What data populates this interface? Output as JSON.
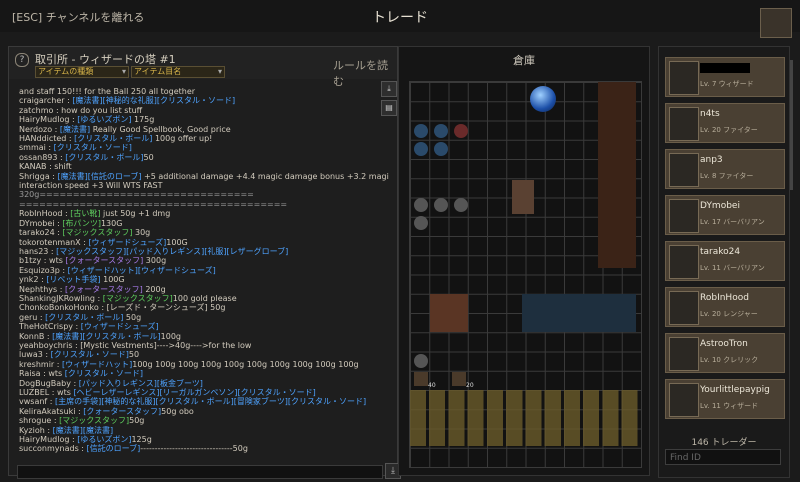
{
  "topbar": {
    "esc_label": "[ESC] チャンネルを離れる",
    "title": "トレード"
  },
  "chat": {
    "header_title": "取引所 - ウィザードの塔 #1",
    "filter_type": "アイテムの種類",
    "filter_name": "アイテム目名",
    "rules_label": "ルールを読む"
  },
  "chat_lines": [
    [
      {
        "t": "and staff 150!!! for the Ball 250 all together",
        "c": ""
      }
    ],
    [
      {
        "t": "craigarcher : ",
        "c": ""
      },
      {
        "t": "[魔法書][神秘的な礼服][クリスタル・ソード]",
        "c": "b"
      }
    ],
    [
      {
        "t": "zatchmo : how do you list stuff",
        "c": ""
      }
    ],
    [
      {
        "t": "HairyMudlog : ",
        "c": ""
      },
      {
        "t": "[ゆるいズボン]",
        "c": "b"
      },
      {
        "t": " 175g",
        "c": ""
      }
    ],
    [
      {
        "t": "Nerdozo : ",
        "c": ""
      },
      {
        "t": "[魔法書]",
        "c": "b"
      },
      {
        "t": " Really Good Spellbook, Good price",
        "c": ""
      }
    ],
    [
      {
        "t": "HANddicted : ",
        "c": ""
      },
      {
        "t": "[クリスタル・ボール]",
        "c": "b"
      },
      {
        "t": " 100g offer up!",
        "c": ""
      }
    ],
    [
      {
        "t": "smmai : ",
        "c": ""
      },
      {
        "t": "[クリスタル・ソード]",
        "c": "b"
      }
    ],
    [
      {
        "t": "ossan893 : ",
        "c": ""
      },
      {
        "t": "[クリスタル・ボール]",
        "c": "b"
      },
      {
        "t": "50",
        "c": ""
      }
    ],
    [
      {
        "t": "KANAB : shift",
        "c": ""
      }
    ],
    [
      {
        "t": "Shrigga : ",
        "c": ""
      },
      {
        "t": "[魔法書][信託のローブ]",
        "c": "b"
      },
      {
        "t": " +5 additional damage +4.4 magic damage bonus +3.2 magic",
        "c": ""
      }
    ],
    [
      {
        "t": "interaction speed +3 Will WTS FAST",
        "c": ""
      }
    ],
    [
      {
        "t": "320g================================",
        "c": "sep"
      }
    ],
    [
      {
        "t": "========================================",
        "c": "sep"
      }
    ],
    [
      {
        "t": "RobInHood : ",
        "c": ""
      },
      {
        "t": "                        [古い靴]",
        "c": "g"
      },
      {
        "t": "  just 50g   +1 dmg",
        "c": ""
      }
    ],
    [
      {
        "t": "DYmobei : ",
        "c": ""
      },
      {
        "t": "[布パンツ]",
        "c": "g"
      },
      {
        "t": "130G",
        "c": ""
      }
    ],
    [
      {
        "t": "tarako24 : ",
        "c": ""
      },
      {
        "t": "[マジックスタッフ]",
        "c": "g"
      },
      {
        "t": " 30g",
        "c": ""
      }
    ],
    [
      {
        "t": "tokorotenmanX : ",
        "c": ""
      },
      {
        "t": "[ウィザードシューズ]",
        "c": "b"
      },
      {
        "t": "100G",
        "c": ""
      }
    ],
    [
      {
        "t": "hans23 : ",
        "c": ""
      },
      {
        "t": "[マジックスタッフ][パッド入りレギンス][礼服][レザーグローブ]",
        "c": "b"
      }
    ],
    [
      {
        "t": "b1tzy : wts ",
        "c": ""
      },
      {
        "t": "[クォータースタッフ]",
        "c": "p"
      },
      {
        "t": " 300g",
        "c": ""
      }
    ],
    [
      {
        "t": "Esquizo3p : ",
        "c": ""
      },
      {
        "t": "[ウィザードハット][ウィザードシューズ]",
        "c": "b"
      }
    ],
    [
      {
        "t": "ynk2 : ",
        "c": ""
      },
      {
        "t": "[リベット手袋]",
        "c": "b"
      },
      {
        "t": " 100G",
        "c": ""
      }
    ],
    [
      {
        "t": "Nephthys : ",
        "c": ""
      },
      {
        "t": "[クォータースタッフ]",
        "c": "p"
      },
      {
        "t": " 200g",
        "c": ""
      }
    ],
    [
      {
        "t": "ShankingJKRowling : ",
        "c": ""
      },
      {
        "t": "[マジックスタッフ]",
        "c": "g"
      },
      {
        "t": "100 gold please",
        "c": ""
      }
    ],
    [
      {
        "t": "ChonkoBonkoHonko : ",
        "c": ""
      },
      {
        "t": "[レーズド・ターンシューズ]",
        "c": ""
      },
      {
        "t": " 50g",
        "c": ""
      }
    ],
    [
      {
        "t": "geru : ",
        "c": ""
      },
      {
        "t": "[クリスタル・ボール]",
        "c": "b"
      },
      {
        "t": " 50g",
        "c": ""
      }
    ],
    [
      {
        "t": "TheHotCrispy : ",
        "c": ""
      },
      {
        "t": "[ウィザードシューズ]",
        "c": "b"
      }
    ],
    [
      {
        "t": "KonnB : ",
        "c": ""
      },
      {
        "t": "[魔法書][クリスタル・ボール]",
        "c": "b"
      },
      {
        "t": "100g",
        "c": ""
      }
    ],
    [
      {
        "t": "yeahboychris : [Mystic Vestments]---->40g---->for the low",
        "c": ""
      }
    ],
    [
      {
        "t": "luwa3 : ",
        "c": ""
      },
      {
        "t": "[クリスタル・ソード]",
        "c": "b"
      },
      {
        "t": "50",
        "c": ""
      }
    ],
    [
      {
        "t": "kreshmir : ",
        "c": ""
      },
      {
        "t": "[ウィザードハット]",
        "c": "b"
      },
      {
        "t": "100g 100g 100g 100g 100g 100g 100g 100g 100g 100g",
        "c": ""
      }
    ],
    [
      {
        "t": "Raisa : wts ",
        "c": ""
      },
      {
        "t": "[クリスタル・ソード]",
        "c": "b"
      }
    ],
    [
      {
        "t": "DogBugBaby : ",
        "c": ""
      },
      {
        "t": "[パッド入りレギンス][板金ブーツ]",
        "c": "b"
      }
    ],
    [
      {
        "t": "LUZBEL : wts ",
        "c": ""
      },
      {
        "t": "[ヘビーレザーレギンス][リーガルガンベソン][クリスタル・ソード]",
        "c": "b"
      }
    ],
    [
      {
        "t": "vwsanf : ",
        "c": ""
      },
      {
        "t": "[主席の手袋][神秘的な礼服][クリスタル・ボール][冒険家ブーツ][クリスタル・ソード]",
        "c": "b"
      }
    ],
    [
      {
        "t": "KeliraAkatsuki : ",
        "c": ""
      },
      {
        "t": "[クォータースタッフ]",
        "c": "b"
      },
      {
        "t": "50g obo",
        "c": ""
      }
    ],
    [
      {
        "t": "shrogue : ",
        "c": ""
      },
      {
        "t": "[マジックスタッフ]",
        "c": "g"
      },
      {
        "t": "50g",
        "c": ""
      }
    ],
    [
      {
        "t": "Kyzioh : ",
        "c": ""
      },
      {
        "t": "[魔法書][魔法書]",
        "c": "b"
      }
    ],
    [
      {
        "t": "HairyMudlog : ",
        "c": ""
      },
      {
        "t": "[ゆるいズボン]",
        "c": "b"
      },
      {
        "t": "125g",
        "c": ""
      }
    ],
    [
      {
        "t": "succonmynads : ",
        "c": ""
      },
      {
        "t": "[信託のローブ]",
        "c": "b"
      },
      {
        "t": "--------------------------------50g",
        "c": ""
      }
    ]
  ],
  "storage": {
    "title": "倉庫",
    "stack_a": "40",
    "stack_b": "20"
  },
  "players": [
    {
      "name": "",
      "level": "Lv. 7 ウィザード",
      "redacted": true
    },
    {
      "name": "n4ts",
      "level": "Lv. 20 ファイター"
    },
    {
      "name": "anp3",
      "level": "Lv. 8 ファイター"
    },
    {
      "name": "DYmobei",
      "level": "Lv. 17 バーバリアン"
    },
    {
      "name": "tarako24",
      "level": "Lv. 11 バーバリアン"
    },
    {
      "name": "RobInHood",
      "level": "Lv. 20 レンジャー"
    },
    {
      "name": "AstrooTron",
      "level": "Lv. 10 クレリック"
    },
    {
      "name": "Yourlittlepaypig",
      "level": "Lv. 11 ウィザード"
    }
  ],
  "trader_count": "146 トレーダー",
  "find_placeholder": "Find ID"
}
